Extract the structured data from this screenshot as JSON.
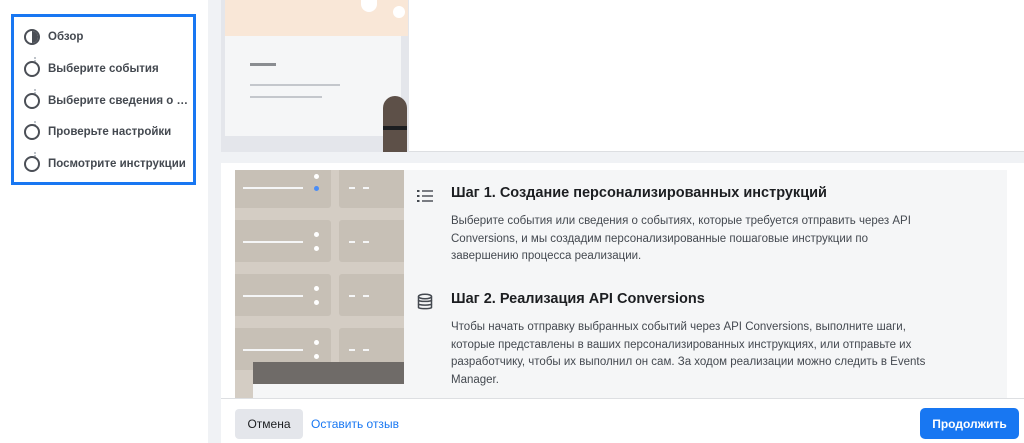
{
  "stepper": {
    "steps": [
      {
        "label": "Обзор",
        "state": "current"
      },
      {
        "label": "Выберите события",
        "state": "todo"
      },
      {
        "label": "Выберите сведения о событиях",
        "state": "todo"
      },
      {
        "label": "Проверьте настройки",
        "state": "todo"
      },
      {
        "label": "Посмотрите инструкции",
        "state": "todo"
      }
    ]
  },
  "content": {
    "step1": {
      "icon": "list-icon",
      "title": "Шаг 1. Создание персонализированных инструкций",
      "text": "Выберите события или сведения о событиях, которые требуется отправить через API Conversions, и мы создадим персонализированные пошаговые инструкции по завершению процесса реализации."
    },
    "step2": {
      "icon": "database-icon",
      "title": "Шаг 2. Реализация API Conversions",
      "text": "Чтобы начать отправку выбранных событий через API Conversions, выполните шаги, которые представлены в ваших персонализированных инструкциях, или отправьте их разработчику, чтобы их выполнил он сам. За ходом реализации можно следить в Events Manager."
    }
  },
  "footer": {
    "cancel_label": "Отмена",
    "feedback_label": "Оставить отзыв",
    "continue_label": "Продолжить"
  },
  "colors": {
    "accent": "#1877f2",
    "page_bg": "#f0f2f5",
    "card_bg": "#ffffff",
    "content_bg": "#f5f6f7",
    "text": "#1c1e21",
    "muted_text": "#444950"
  }
}
